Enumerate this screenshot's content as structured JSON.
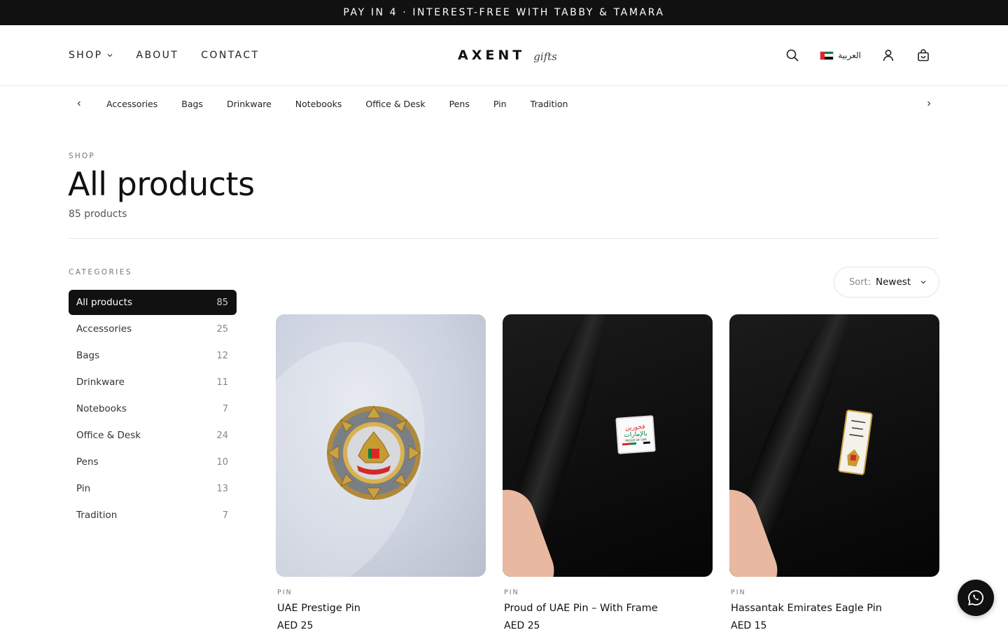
{
  "announcement": "PAY IN 4 · INTEREST-FREE WITH TABBY & TAMARA",
  "nav": {
    "shop": "SHOP",
    "about": "ABOUT",
    "contact": "CONTACT"
  },
  "brand": {
    "name": "AXENT",
    "tagline": "gifts"
  },
  "header": {
    "language": "العربية"
  },
  "category_bar": [
    "Accessories",
    "Bags",
    "Drinkware",
    "Notebooks",
    "Office & Desk",
    "Pens",
    "Pin",
    "Tradition"
  ],
  "page": {
    "breadcrumb": "SHOP",
    "title": "All products",
    "count": "85 products"
  },
  "sidebar": {
    "heading": "CATEGORIES",
    "items": [
      {
        "label": "All products",
        "count": "85"
      },
      {
        "label": "Accessories",
        "count": "25"
      },
      {
        "label": "Bags",
        "count": "12"
      },
      {
        "label": "Drinkware",
        "count": "11"
      },
      {
        "label": "Notebooks",
        "count": "7"
      },
      {
        "label": "Office & Desk",
        "count": "24"
      },
      {
        "label": "Pens",
        "count": "10"
      },
      {
        "label": "Pin",
        "count": "13"
      },
      {
        "label": "Tradition",
        "count": "7"
      }
    ]
  },
  "sort": {
    "label": "Sort:",
    "value": "Newest"
  },
  "products": [
    {
      "category": "PIN",
      "name": "UAE Prestige Pin",
      "price": "AED 25"
    },
    {
      "category": "PIN",
      "name": "Proud of UAE Pin – With Frame",
      "price": "AED 25"
    },
    {
      "category": "PIN",
      "name": "Hassantak Emirates Eagle Pin",
      "price": "AED 15"
    }
  ],
  "pin_art": {
    "proud_line1": "فخورين",
    "proud_line2": "بالإمارات",
    "proud_small": "PROUD OF UAE"
  },
  "colors": {
    "dark": "#111111",
    "muted": "#777777",
    "border": "#e6e6e6",
    "uae_red": "#e0242a",
    "uae_green": "#00843d"
  }
}
